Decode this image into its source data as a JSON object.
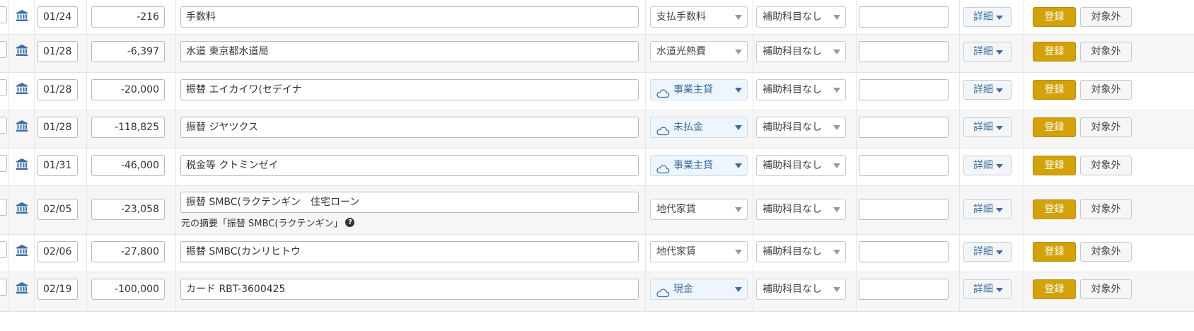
{
  "labels": {
    "detail": "詳細",
    "register": "登録",
    "exclude": "対象外",
    "orig_prefix": "元の摘要「",
    "orig_suffix": "」"
  },
  "colors": {
    "register_bg": "#d2a208",
    "link_blue": "#3b6ea6",
    "select_blue_bg": "#eef5fc"
  },
  "rows": [
    {
      "date": "01/24",
      "amount": "-216",
      "description": "手数料",
      "account": "支払手数料",
      "account_style": "plain",
      "sub_account": "補助科目なし",
      "memo": ""
    },
    {
      "date": "01/28",
      "amount": "-6,397",
      "description": "水道 東京都水道局",
      "account": "水道光熱費",
      "account_style": "plain",
      "sub_account": "補助科目なし",
      "memo": ""
    },
    {
      "date": "01/28",
      "amount": "-20,000",
      "description": "振替 エイカイワ(セデイナ",
      "account": "事業主貸",
      "account_style": "suggested",
      "sub_account": "補助科目なし",
      "memo": ""
    },
    {
      "date": "01/28",
      "amount": "-118,825",
      "description": "振替 ジヤツクス",
      "account": "未払金",
      "account_style": "suggested",
      "sub_account": "補助科目なし",
      "memo": ""
    },
    {
      "date": "01/31",
      "amount": "-46,000",
      "description": "税金等 クトミンゼイ",
      "account": "事業主貸",
      "account_style": "suggested",
      "sub_account": "補助科目なし",
      "memo": ""
    },
    {
      "date": "02/05",
      "amount": "-23,058",
      "description": "振替 SMBC(ラクテンギン　住宅ローン",
      "account": "地代家賃",
      "account_style": "plain",
      "sub_account": "補助科目なし",
      "memo": "",
      "original_description": "振替 SMBC(ラクテンギン"
    },
    {
      "date": "02/06",
      "amount": "-27,800",
      "description": "振替 SMBC(カンリヒトウ",
      "account": "地代家賃",
      "account_style": "plain",
      "sub_account": "補助科目なし",
      "memo": ""
    },
    {
      "date": "02/19",
      "amount": "-100,000",
      "description": "カード RBT-3600425",
      "account": "現金",
      "account_style": "suggested",
      "sub_account": "補助科目なし",
      "memo": ""
    }
  ]
}
